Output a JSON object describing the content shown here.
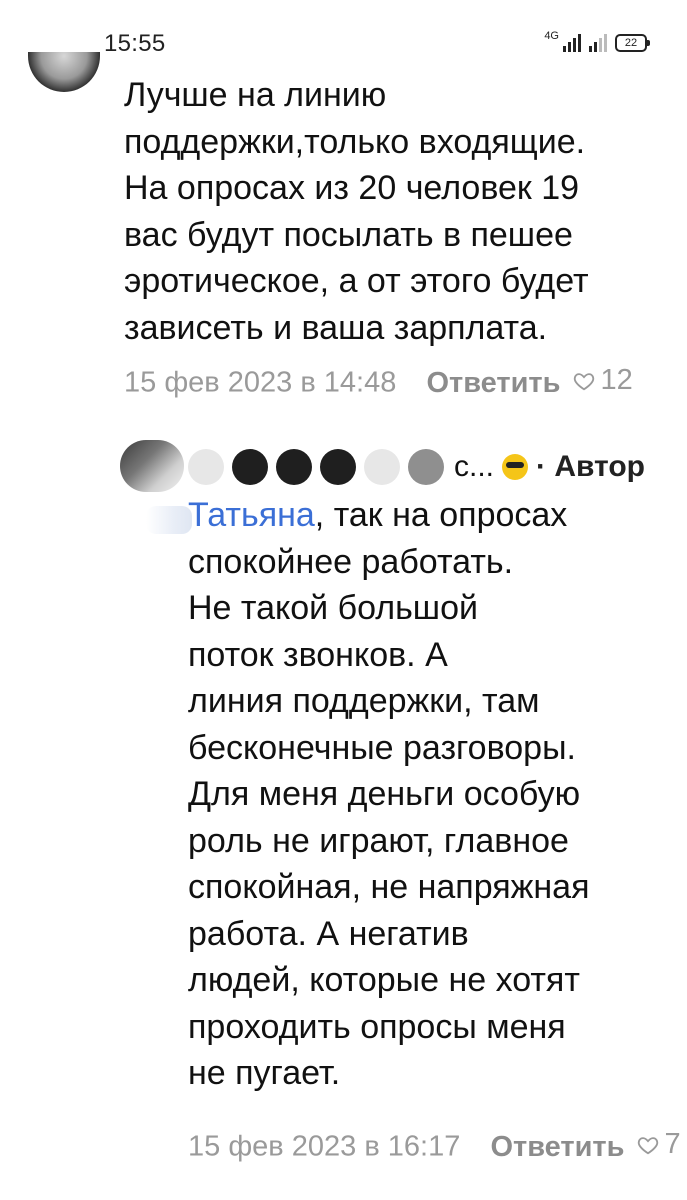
{
  "status_bar": {
    "time": "15:55",
    "network_label": "4G",
    "battery_level": "22"
  },
  "comment1": {
    "text": "Лучше на линию\nподдержки,только входящие.\nНа опросах из 20 человек 19\nвас будут посылать в пешее\nэротическое, а от этого будет\nзависеть и ваша зарплата.",
    "date": "15 фев 2023 в 14:48",
    "reply_label": "Ответить",
    "likes": "12",
    "like_icon": "heart-icon"
  },
  "comment2": {
    "author_suffix": "с...",
    "author_emoji": "smiling-face-with-sunglasses",
    "author_badge": "· Автор",
    "mention": "Татьяна",
    "text_after_mention": ", так на опросах",
    "text": "спокойнее работать.\nНе такой большой\nпоток звонков. А\nлиния поддержки, там\nбесконечные разговоры.\nДля меня деньги особую\nроль не играют, главное\nспокойная, не напряжная\nработа. А негатив\nлюдей, которые не хотят\nпроходить опросы меня\nне пугает.",
    "date": "15 фев 2023 в 16:17",
    "reply_label": "Ответить",
    "likes": "7",
    "like_icon": "heart-icon"
  },
  "colors": {
    "mention": "#3b6fd6",
    "meta_gray": "#9a9a9a",
    "text": "#111111"
  }
}
